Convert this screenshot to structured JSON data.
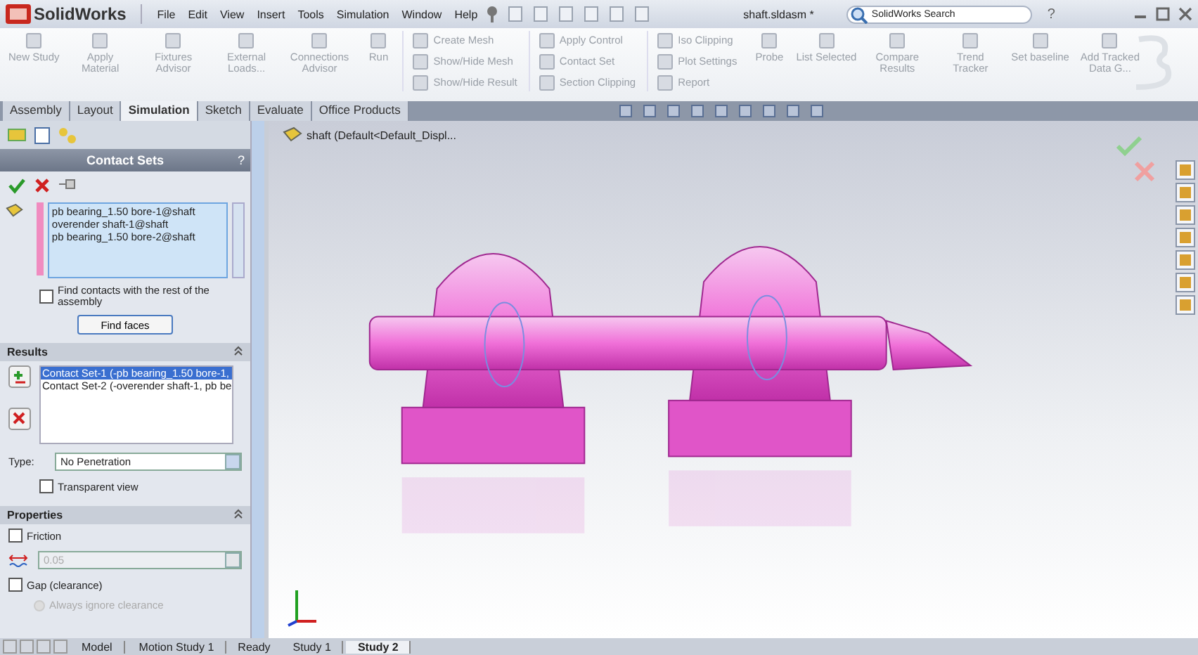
{
  "title_bar": {
    "logo": "SolidWorks",
    "menu": [
      "File",
      "Edit",
      "View",
      "Insert",
      "Tools",
      "Simulation",
      "Window",
      "Help"
    ],
    "document_title": "shaft.sldasm *",
    "search_placeholder": "SolidWorks Search",
    "help": "?"
  },
  "ribbon": {
    "large_buttons": [
      {
        "label": "New Study"
      },
      {
        "label": "Apply Material"
      },
      {
        "label": "Fixtures Advisor"
      },
      {
        "label": "External Loads..."
      },
      {
        "label": "Connections Advisor"
      },
      {
        "label": "Run"
      }
    ],
    "small_columns": [
      [
        "Create Mesh",
        "Show/Hide Mesh",
        "Show/Hide Result"
      ],
      [
        "Apply Control",
        "Contact Set",
        "Section Clipping"
      ],
      [
        "Iso Clipping",
        "Plot Settings",
        "Report"
      ]
    ],
    "more_buttons": [
      {
        "label": "Probe"
      },
      {
        "label": "List Selected"
      },
      {
        "label": "Compare Results"
      },
      {
        "label": "Trend Tracker"
      },
      {
        "label": "Set baseline"
      },
      {
        "label": "Add Tracked Data G..."
      }
    ]
  },
  "command_tabs": [
    {
      "label": "Assembly",
      "selected": false
    },
    {
      "label": "Layout",
      "selected": false
    },
    {
      "label": "Simulation",
      "selected": true
    },
    {
      "label": "Sketch",
      "selected": false
    },
    {
      "label": "Evaluate",
      "selected": false
    },
    {
      "label": "Office Products",
      "selected": false
    }
  ],
  "panel": {
    "title": "Contact Sets",
    "help": "?",
    "selection_items": [
      "pb bearing_1.50 bore-1@shaft",
      "overender shaft-1@shaft",
      "pb bearing_1.50 bore-2@shaft"
    ],
    "find_contacts": {
      "label": "Find contacts with the rest of the assembly",
      "checked": false
    },
    "find_button": "Find faces",
    "results": {
      "title": "Results",
      "items": [
        {
          "label": "Contact Set-1 (-pb bearing_1.50 bore-1,",
          "selected": true
        },
        {
          "label": "Contact Set-2 (-overender shaft-1, pb be",
          "selected": false
        }
      ],
      "type_label": "Type:",
      "type_value": "No Penetration",
      "transparent": {
        "label": "Transparent view",
        "checked": false
      }
    },
    "properties": {
      "title": "Properties",
      "friction": {
        "label": "Friction",
        "checked": false
      },
      "friction_value": "0.05",
      "gap": {
        "label": "Gap (clearance)",
        "checked": false
      },
      "gap_option": {
        "label": "Always ignore clearance",
        "disabled": true
      }
    }
  },
  "viewport": {
    "tree_label": "shaft  (Default<Default_Displ..."
  },
  "bottom_tabs": [
    {
      "label": "Model",
      "selected": false
    },
    {
      "label": "Motion Study 1",
      "selected": false
    },
    {
      "label": "Study 1",
      "selected": false
    },
    {
      "label": "Study 2",
      "selected": true
    }
  ],
  "status": "Ready"
}
